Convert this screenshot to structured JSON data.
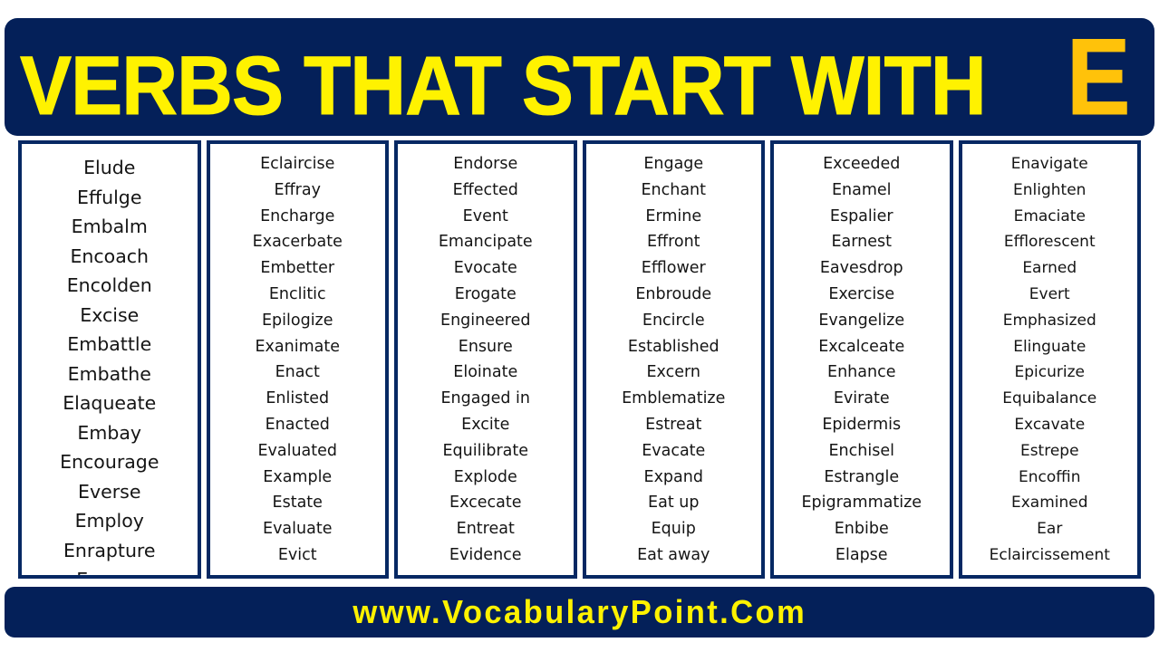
{
  "header": {
    "title_main": "VERBS THAT START WITH",
    "title_letter": "E",
    "background_color": "#042059",
    "title_color": "#FFF200",
    "letter_color": "#FFC20A"
  },
  "footer": {
    "website": "www.VocabularyPoint.Com",
    "background_color": "#042059",
    "text_color": "#FFF200"
  },
  "columns": [
    {
      "id": "column-1",
      "words": [
        "Elude",
        "Effulge",
        "Embalm",
        "Encoach",
        "Encolden",
        "Excise",
        "Embattle",
        "Embathe",
        "Elaqueate",
        "Embay",
        "Encourage",
        "Everse",
        "Employ",
        "Enrapture",
        "Escape"
      ]
    },
    {
      "id": "column-2",
      "words": [
        "Eclaircise",
        "Effray",
        "Encharge",
        "Exacerbate",
        "Embetter",
        "Enclitic",
        "Epilogize",
        "Exanimate",
        "Enact",
        "Enlisted",
        "Enacted",
        "Evaluated",
        "Example",
        "Estate",
        "Evaluate",
        "Evict"
      ]
    },
    {
      "id": "column-3",
      "words": [
        "Endorse",
        "Effected",
        "Event",
        "Emancipate",
        "Evocate",
        "Erogate",
        "Engineered",
        "Ensure",
        "Eloinate",
        "Engaged in",
        "Excite",
        "Equilibrate",
        "Explode",
        "Excecate",
        "Entreat",
        "Evidence"
      ]
    },
    {
      "id": "column-4",
      "words": [
        "Engage",
        "Enchant",
        "Ermine",
        "Effront",
        "Efflower",
        "Enbroude",
        "Encircle",
        "Established",
        "Excern",
        "Emblematize",
        "Estreat",
        "Evacate",
        "Expand",
        "Eat up",
        "Equip",
        "Eat away"
      ]
    },
    {
      "id": "column-5",
      "words": [
        "Exceeded",
        "Enamel",
        "Espalier",
        "Earnest",
        "Eavesdrop",
        "Exercise",
        "Evangelize",
        "Excalceate",
        "Enhance",
        "Evirate",
        "Epidermis",
        "Enchisel",
        "Estrangle",
        "Epigrammatize",
        "Enbibe",
        "Elapse"
      ]
    },
    {
      "id": "column-6",
      "words": [
        "Enavigate",
        "Enlighten",
        "Emaciate",
        "Efflorescent",
        "Earned",
        "Evert",
        "Emphasized",
        "Elinguate",
        "Epicurize",
        "Equibalance",
        "Excavate",
        "Estrepe",
        "Encoffin",
        "Examined",
        "Ear",
        "Eclaircissement"
      ]
    }
  ]
}
